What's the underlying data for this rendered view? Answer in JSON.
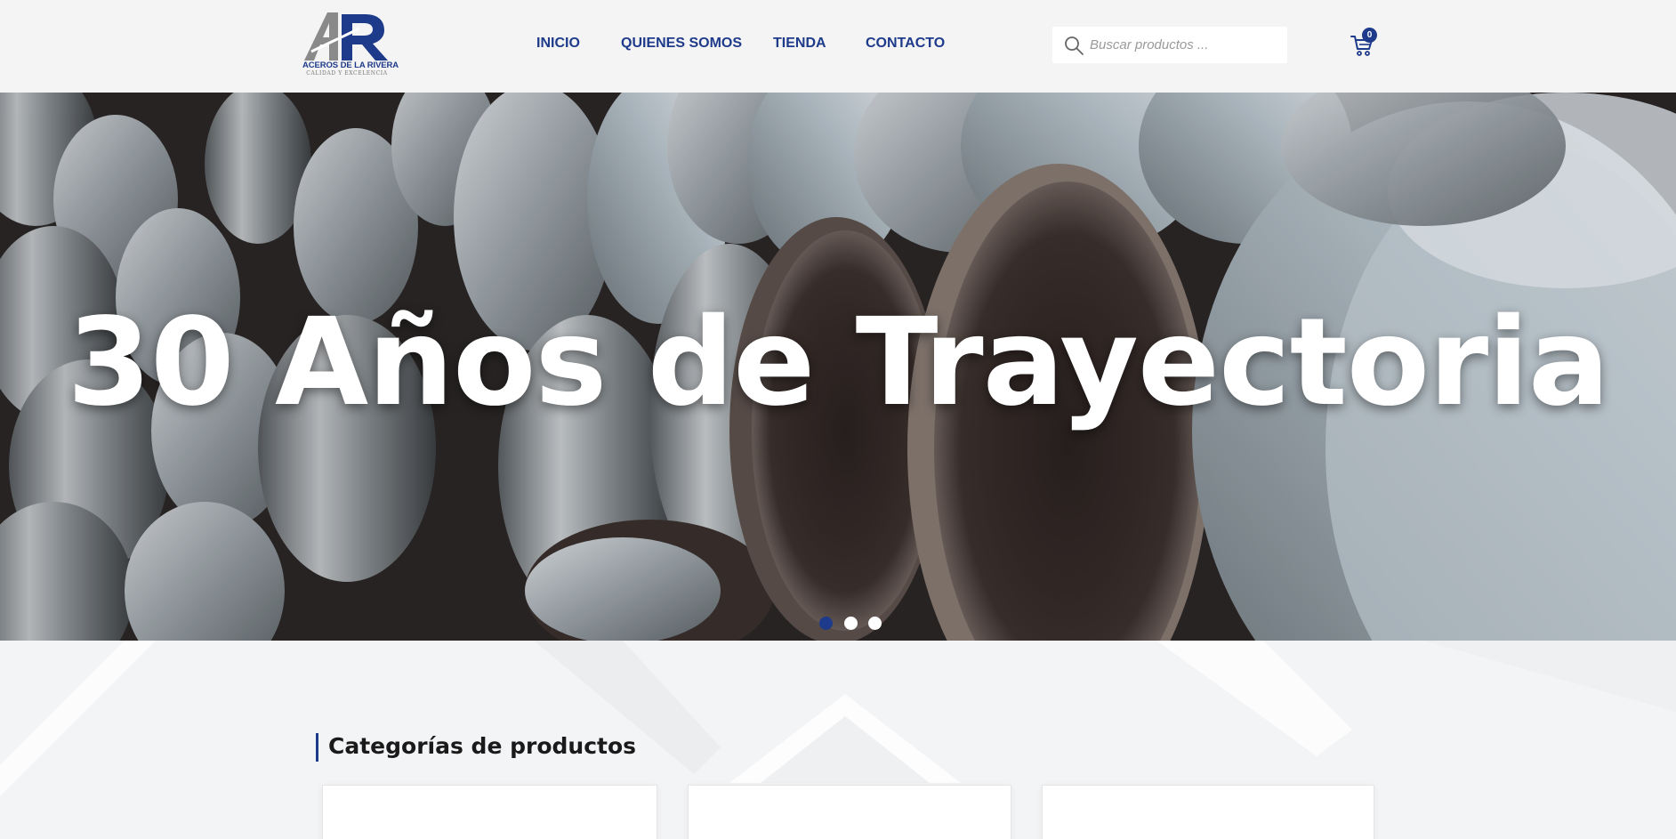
{
  "header": {
    "logo": {
      "mark": "AR",
      "brand": "ACEROS DE LA RIVERA",
      "tagline": "CALIDAD Y EXCELENCIA"
    },
    "nav": [
      {
        "label": "INICIO"
      },
      {
        "label": "QUIENES SOMOS"
      },
      {
        "label": "TIENDA"
      },
      {
        "label": "CONTACTO"
      }
    ],
    "search": {
      "placeholder": "Buscar productos ..."
    },
    "cart": {
      "count": "0"
    }
  },
  "hero": {
    "title": "30 Años de Trayectoria",
    "slides_total": 3,
    "active_slide": 1
  },
  "categories": {
    "title": "Categorías de productos"
  },
  "colors": {
    "brand": "#1e3a8a",
    "header_bg": "#f4f4f4",
    "section_bg": "#f3f4f6"
  }
}
